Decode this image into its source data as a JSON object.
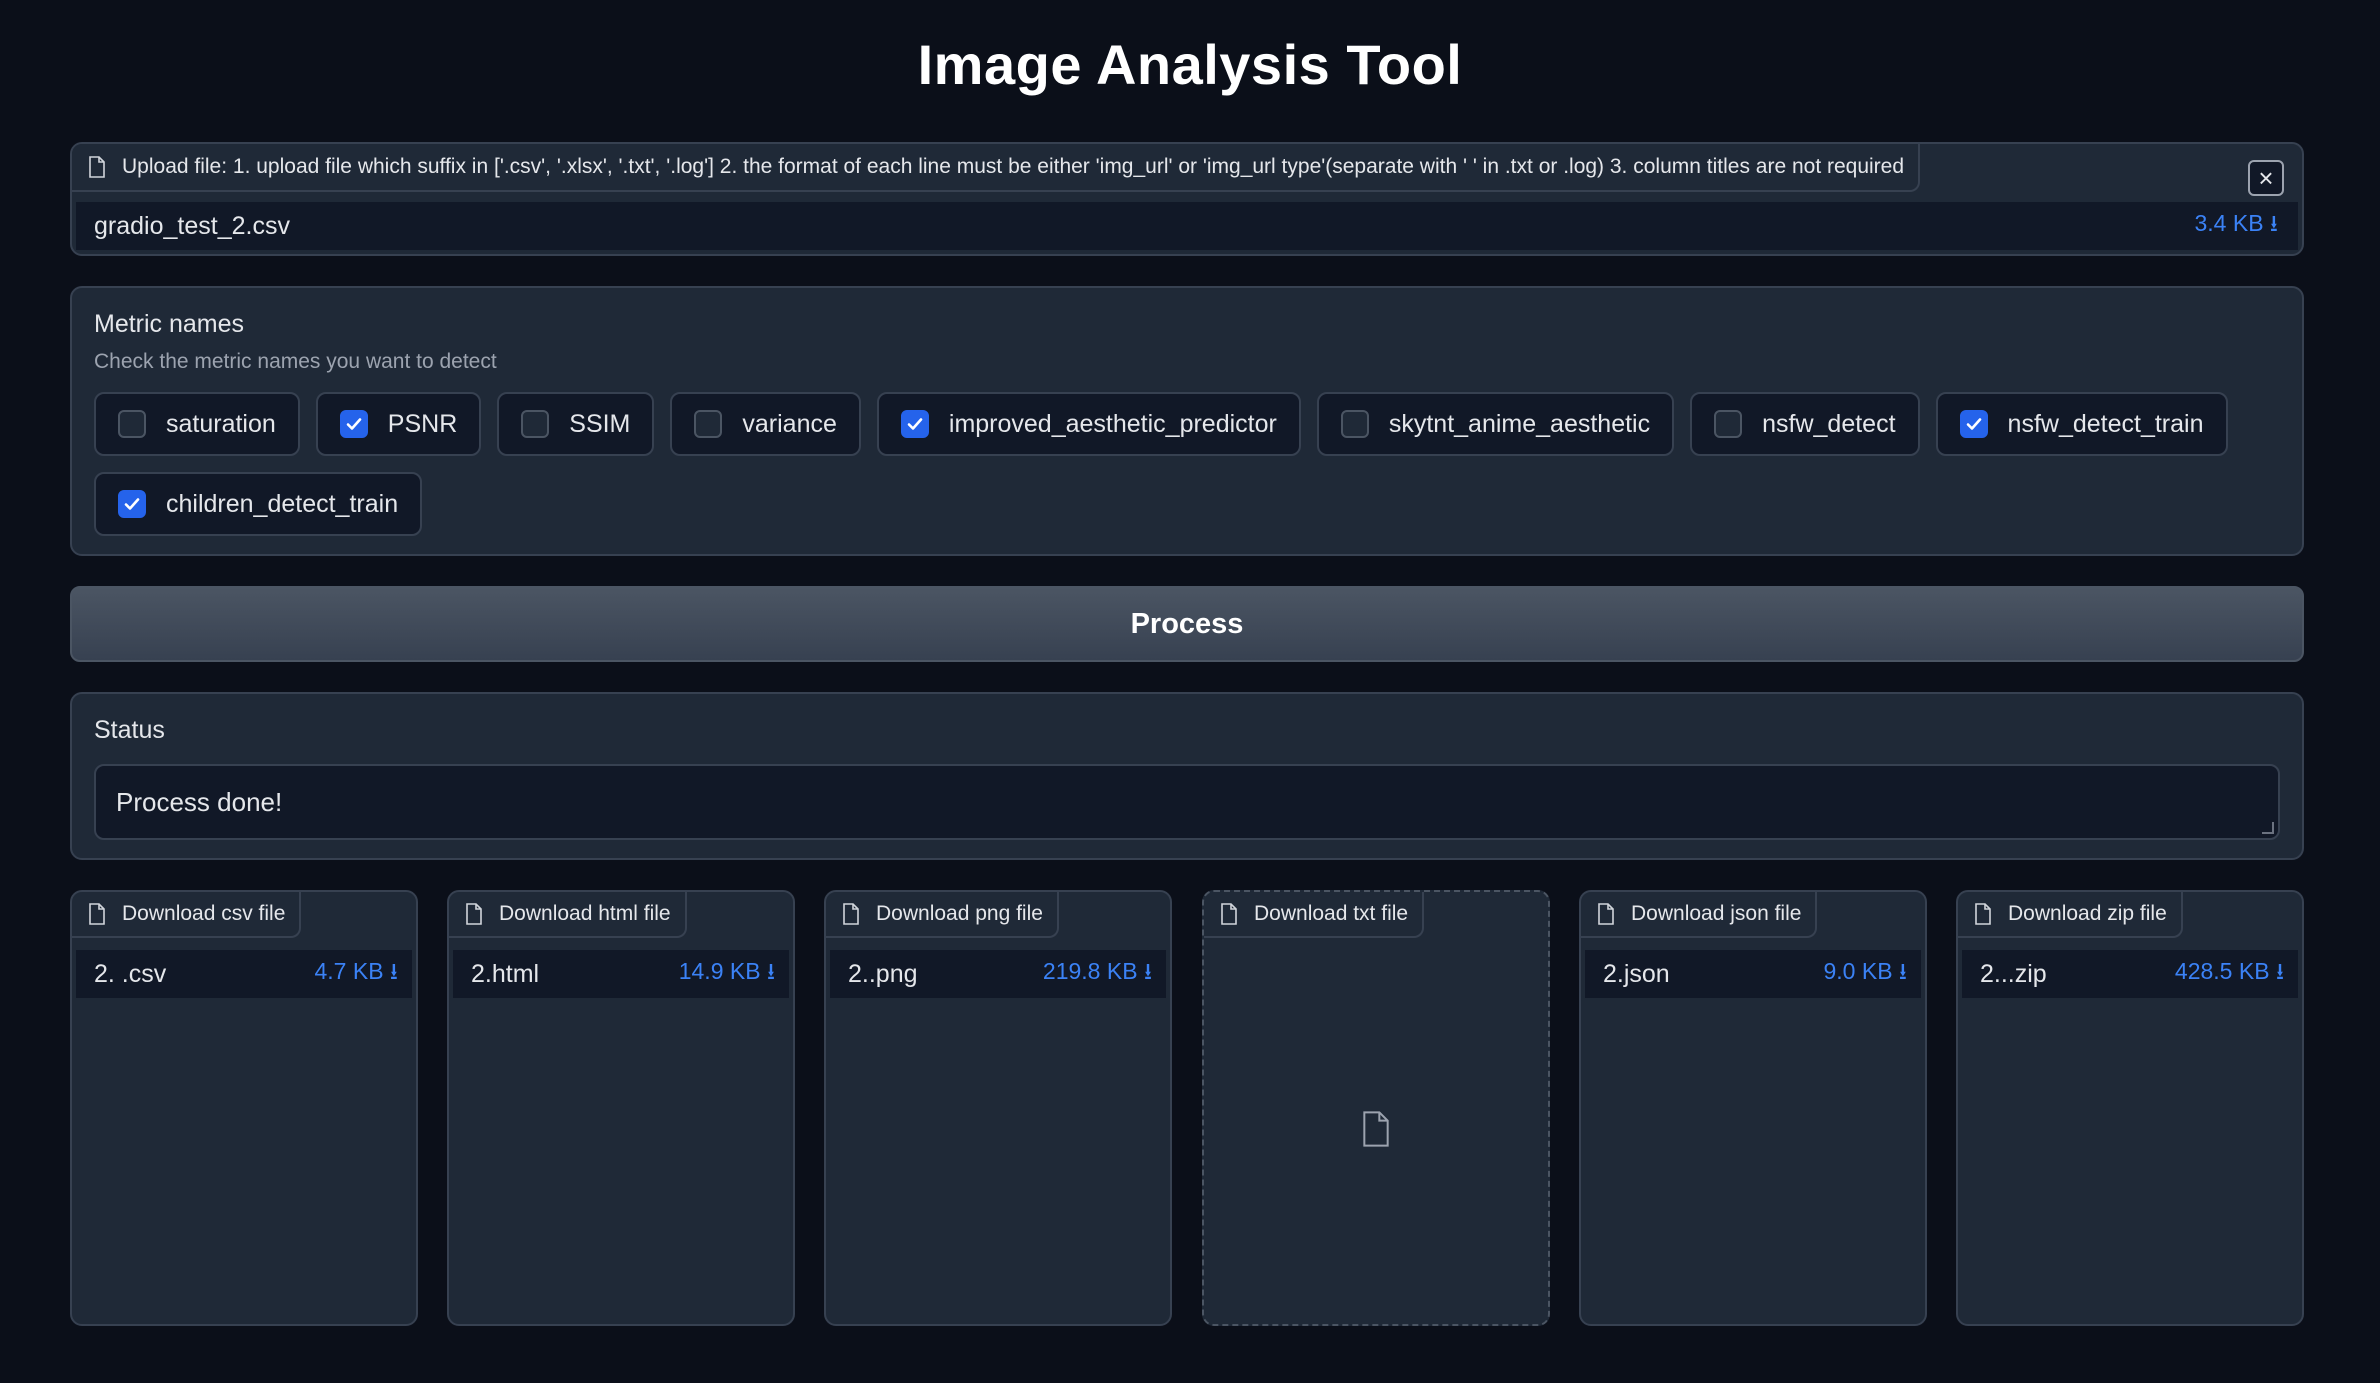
{
  "title": "Image Analysis Tool",
  "upload": {
    "label": "Upload file: 1. upload file which suffix in ['.csv', '.xlsx', '.txt', '.log'] 2. the format of each line must be either 'img_url' or 'img_url type'(separate with ' ' in .txt or .log) 3. column titles are not required",
    "file_name": "gradio_test_2.csv",
    "file_size": "3.4 KB ⭳",
    "close_symbol": "×"
  },
  "metrics": {
    "title": "Metric names",
    "info": "Check the metric names you want to detect",
    "options": [
      {
        "label": "saturation",
        "checked": false
      },
      {
        "label": "PSNR",
        "checked": true
      },
      {
        "label": "SSIM",
        "checked": false
      },
      {
        "label": "variance",
        "checked": false
      },
      {
        "label": "improved_aesthetic_predictor",
        "checked": true
      },
      {
        "label": "skytnt_anime_aesthetic",
        "checked": false
      },
      {
        "label": "nsfw_detect",
        "checked": false
      },
      {
        "label": "nsfw_detect_train",
        "checked": true
      },
      {
        "label": "children_detect_train",
        "checked": true
      }
    ]
  },
  "process_button": "Process",
  "status": {
    "label": "Status",
    "value": "Process done!"
  },
  "downloads": [
    {
      "label": "Download csv file",
      "file_name": "2. .csv",
      "file_size": "4.7 KB ⭳"
    },
    {
      "label": "Download html file",
      "file_name": "2.html",
      "file_size": "14.9 KB ⭳"
    },
    {
      "label": "Download png file",
      "file_name": "2..png",
      "file_size": "219.8 KB ⭳"
    },
    {
      "label": "Download txt file",
      "file_name": null,
      "file_size": null
    },
    {
      "label": "Download json file",
      "file_name": "2.json",
      "file_size": "9.0 KB ⭳"
    },
    {
      "label": "Download zip file",
      "file_name": "2...zip",
      "file_size": "428.5 KB ⭳"
    }
  ],
  "icons": {
    "file": "file-icon",
    "check": "check-icon",
    "close": "close-icon"
  },
  "colors": {
    "background": "#0b0f19",
    "panel": "#1f2937",
    "accent": "#2563eb",
    "link": "#3b82f6"
  }
}
